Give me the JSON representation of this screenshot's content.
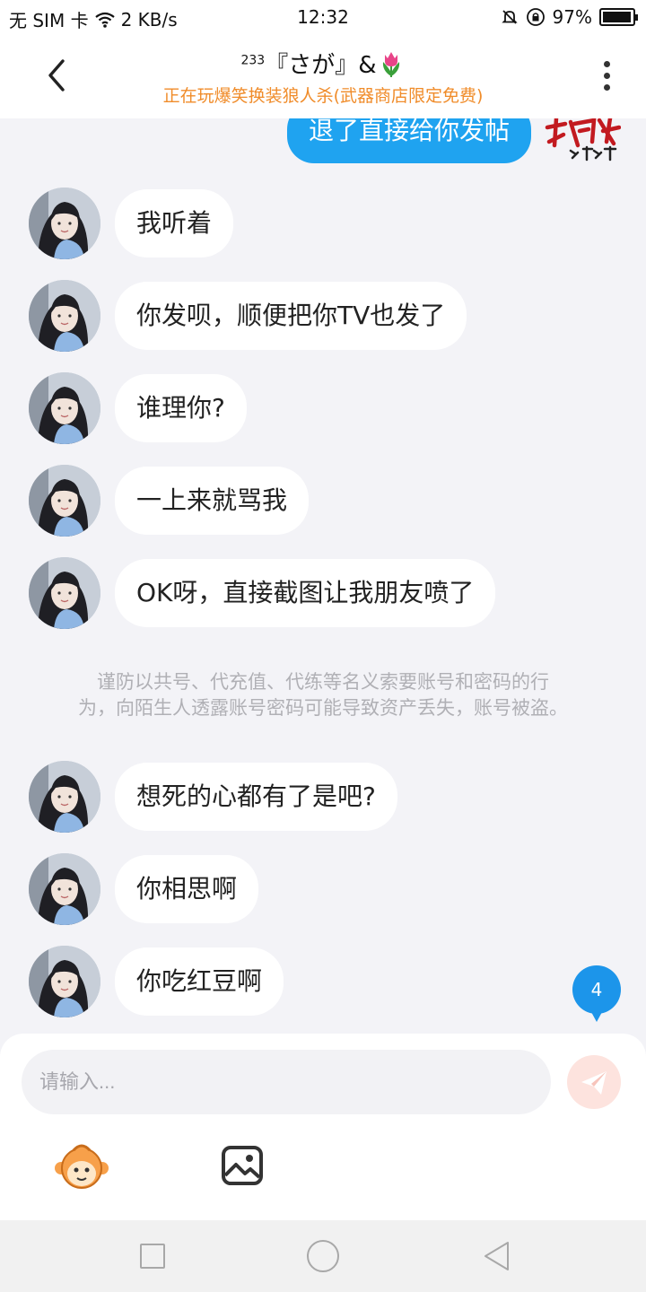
{
  "status_bar": {
    "carrier": "无 SIM 卡",
    "net_speed": "2 KB/s",
    "time": "12:32",
    "battery_pct": "97%",
    "battery_level": 0.97
  },
  "header": {
    "title_sup": "233",
    "title_text": "『さが』&",
    "title_emoji": "tulip-icon",
    "subtitle": "正在玩爆笑换装狼人杀(武器商店限定免费)"
  },
  "chat": {
    "sent_message": "退了直接给你发帖",
    "sent_avatar_text": "权威 洛洛",
    "messages": [
      {
        "text": "我听着"
      },
      {
        "text": "你发呗，顺便把你TV也发了"
      },
      {
        "text": "谁理你?"
      },
      {
        "text": "一上来就骂我"
      },
      {
        "text": "OK呀，直接截图让我朋友喷了"
      }
    ],
    "notice_line1": "谨防以共号、代充值、代练等名义索要账号和密码的行",
    "notice_line2": "为，向陌生人透露账号密码可能导致资产丢失，账号被盗。",
    "messages_after": [
      {
        "text": "想死的心都有了是吧?"
      },
      {
        "text": "你相思啊"
      },
      {
        "text": "你吃红豆啊"
      }
    ],
    "unread_badge": "4"
  },
  "input": {
    "placeholder": "请输入...",
    "value": ""
  },
  "colors": {
    "accent_blue": "#1fa3f0",
    "subtitle_orange": "#f08c2a",
    "send_disabled": "#fde3de"
  }
}
